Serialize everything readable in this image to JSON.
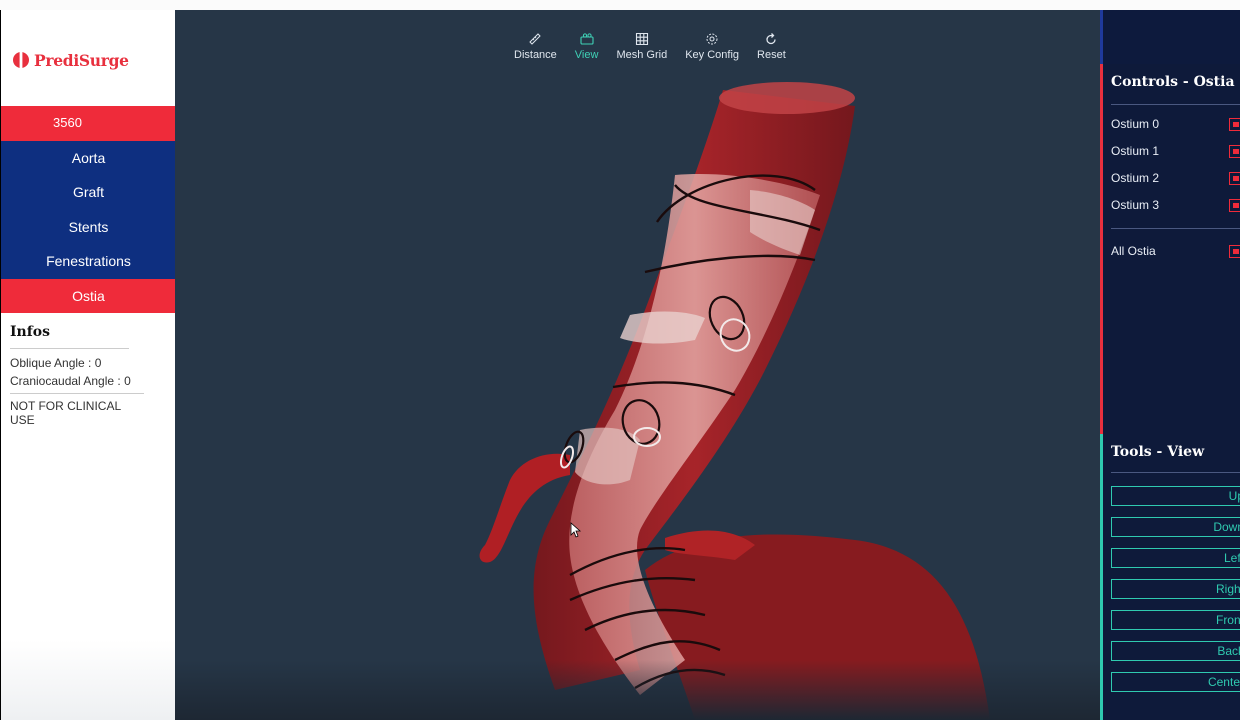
{
  "app": {
    "brand": "PrediSurge",
    "brand_color": "#e8303e",
    "nav_blue": "#0e2f80",
    "accent_teal": "#2fcab0"
  },
  "sidebar": {
    "case_id": "3560",
    "items": [
      {
        "label": "Aorta"
      },
      {
        "label": "Graft"
      },
      {
        "label": "Stents"
      },
      {
        "label": "Fenestrations"
      },
      {
        "label": "Ostia"
      }
    ],
    "active_item": "Ostia"
  },
  "infos": {
    "title": "Infos",
    "oblique_angle": "Oblique Angle : 0",
    "craniocaudal_angle": "Craniocaudal Angle : 0",
    "disclaimer": "NOT FOR CLINICAL USE"
  },
  "toolbar": {
    "items": [
      {
        "label": "Distance",
        "icon": "ruler-icon"
      },
      {
        "label": "View",
        "icon": "camera-icon",
        "active": true
      },
      {
        "label": "Mesh Grid",
        "icon": "grid-icon"
      },
      {
        "label": "Key Config",
        "icon": "gear-icon"
      },
      {
        "label": "Reset",
        "icon": "reset-icon"
      }
    ]
  },
  "controls": {
    "title": "Controls - Ostia",
    "ostia": [
      {
        "label": "Ostium 0",
        "checked": true
      },
      {
        "label": "Ostium 1",
        "checked": true
      },
      {
        "label": "Ostium 2",
        "checked": true
      },
      {
        "label": "Ostium 3",
        "checked": true
      }
    ],
    "all": {
      "label": "All Ostia",
      "checked": true
    }
  },
  "tools": {
    "title": "Tools - View",
    "buttons": [
      "Up",
      "Down",
      "Left",
      "Right",
      "Front",
      "Back",
      "Center"
    ]
  }
}
